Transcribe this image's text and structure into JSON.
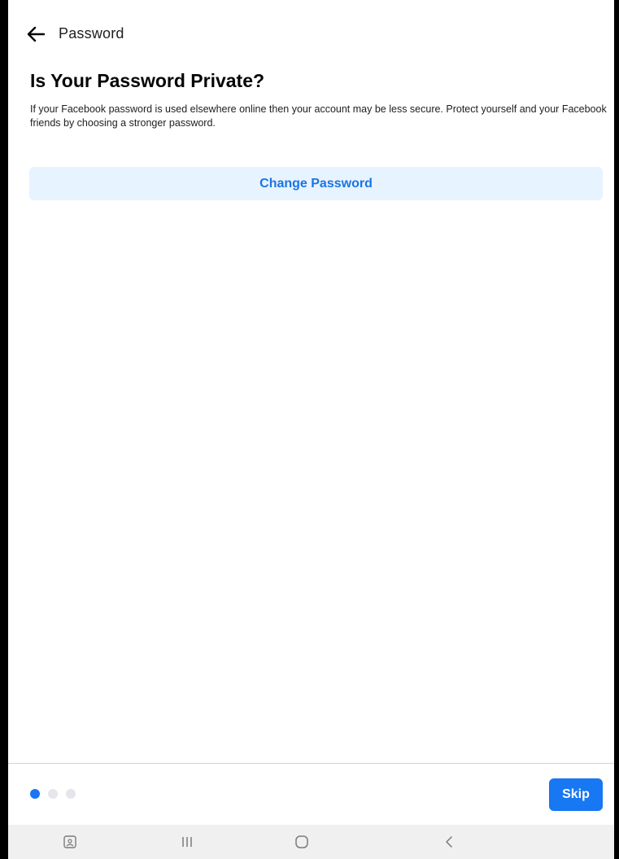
{
  "header": {
    "title": "Password",
    "back_icon": "arrow-left-icon"
  },
  "main": {
    "heading": "Is Your Password Private?",
    "description": "If your Facebook password is used elsewhere online then your account may be less secure. Protect yourself and your Facebook friends by choosing a stronger password.",
    "change_password_label": "Change Password"
  },
  "footer": {
    "pager": {
      "total_pages": 3,
      "current_page": 1
    },
    "skip_label": "Skip"
  },
  "system_nav": {
    "items": [
      {
        "icon": "screenshot-icon"
      },
      {
        "icon": "recent-apps-icon"
      },
      {
        "icon": "home-icon"
      },
      {
        "icon": "back-chevron-icon"
      }
    ]
  },
  "colors": {
    "accent": "#1877f2",
    "button_light_bg": "#e7f3ff",
    "button_light_text": "#1b74e4",
    "dot_inactive": "#e4e6eb"
  }
}
